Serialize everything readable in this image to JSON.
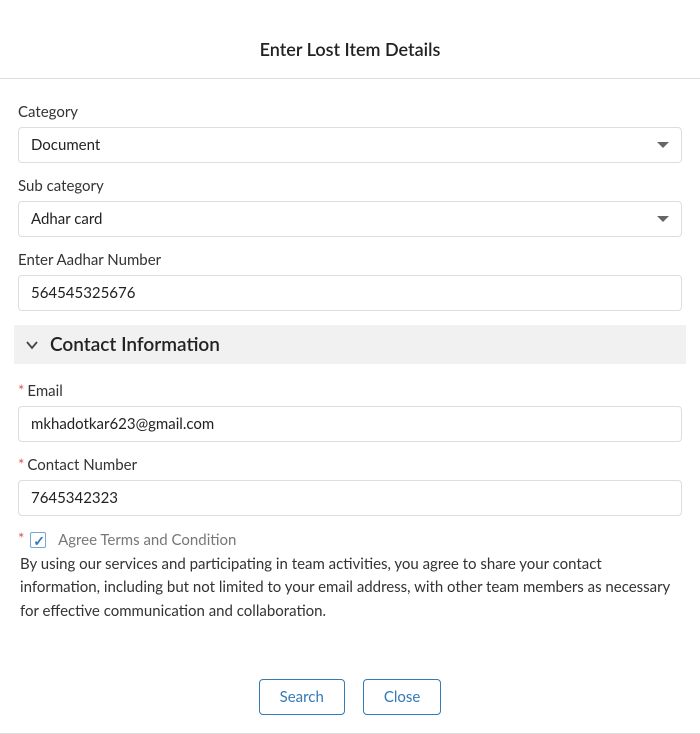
{
  "title": "Enter Lost Item Details",
  "fields": {
    "category": {
      "label": "Category",
      "value": "Document"
    },
    "subcategory": {
      "label": "Sub category",
      "value": "Adhar card"
    },
    "aadhar": {
      "label": "Enter Aadhar Number",
      "value": "564545325676"
    },
    "email": {
      "label": "Email",
      "value": "mkhadotkar623@gmail.com"
    },
    "contact": {
      "label": "Contact Number",
      "value": "7645342323"
    }
  },
  "section": {
    "contact_info": "Contact Information"
  },
  "terms": {
    "label": "Agree Terms and Condition",
    "checked": true,
    "text": "By using our services and participating in team activities, you agree to share your contact information, including but not limited to your email address, with other team members as necessary for effective communication and collaboration."
  },
  "buttons": {
    "search": "Search",
    "close": "Close"
  }
}
